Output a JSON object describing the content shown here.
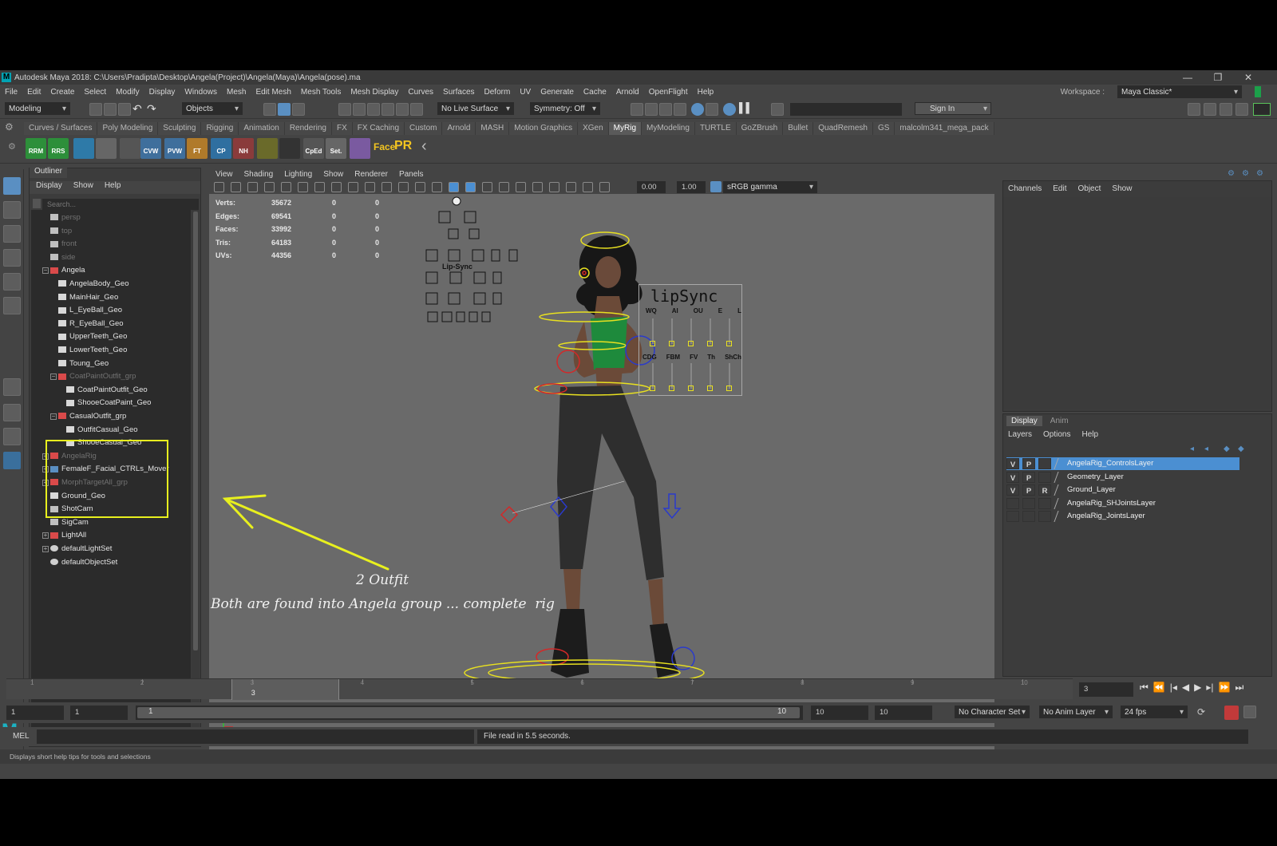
{
  "title": "Autodesk Maya 2018: C:\\Users\\Pradipta\\Desktop\\Angela(Project)\\Angela(Maya)\\Angela(pose).ma",
  "window_buttons": [
    "—",
    "❐",
    "✕"
  ],
  "menu": [
    "File",
    "Edit",
    "Create",
    "Select",
    "Modify",
    "Display",
    "Windows",
    "Mesh",
    "Edit Mesh",
    "Mesh Tools",
    "Mesh Display",
    "Curves",
    "Surfaces",
    "Deform",
    "UV",
    "Generate",
    "Cache",
    "Arnold",
    "OpenFlight",
    "Help"
  ],
  "workspace": {
    "label": "Workspace :",
    "value": "Maya Classic*"
  },
  "status": {
    "mode": "Modeling",
    "select_field": "Objects",
    "live_surface": "No Live Surface",
    "symmetry": "Symmetry: Off",
    "sign_in": "Sign In"
  },
  "shelf_tabs": [
    "Curves / Surfaces",
    "Poly Modeling",
    "Sculpting",
    "Rigging",
    "Animation",
    "Rendering",
    "FX",
    "FX Caching",
    "Custom",
    "Arnold",
    "MASH",
    "Motion Graphics",
    "XGen",
    "MyRig",
    "MyModeling",
    "TURTLE",
    "GoZBrush",
    "Bullet",
    "QuadRemesh",
    "GS",
    "malcolm341_mega_pack"
  ],
  "shelf_active": "MyRig",
  "shelf_buttons": [
    {
      "label": "RRM",
      "color": "#2d8f3a"
    },
    {
      "label": "RRS",
      "color": "#2d8f3a"
    },
    {
      "label": "",
      "color": "#2e7aa8"
    },
    {
      "label": "",
      "color": "#666"
    },
    {
      "label": "",
      "color": "#555"
    },
    {
      "label": "CVW",
      "color": "#3f6f9c"
    },
    {
      "label": "PVW",
      "color": "#3f6f9c"
    },
    {
      "label": "FT",
      "color": "#b07a2a"
    },
    {
      "label": "CP",
      "color": "#2f6fa0"
    },
    {
      "label": "NH",
      "color": "#8a3b3b"
    },
    {
      "label": "",
      "color": "#6a6a2a"
    },
    {
      "label": "",
      "color": "#333"
    },
    {
      "label": "CpEd",
      "color": "#555"
    },
    {
      "label": "Set.",
      "color": "#666"
    },
    {
      "label": "",
      "color": "#7a5aa0"
    }
  ],
  "shelf_text": {
    "face": "Face",
    "pr": "PR"
  },
  "outliner": {
    "tab": "Outliner",
    "menu": [
      "Display",
      "Show",
      "Help"
    ],
    "search_placeholder": "Search...",
    "items": [
      {
        "label": "persp",
        "dim": true,
        "icon": "camera-icon",
        "indent": 0,
        "exp": ""
      },
      {
        "label": "top",
        "dim": true,
        "icon": "camera-icon",
        "indent": 0,
        "exp": ""
      },
      {
        "label": "front",
        "dim": true,
        "icon": "camera-icon",
        "indent": 0,
        "exp": ""
      },
      {
        "label": "side",
        "dim": true,
        "icon": "camera-icon",
        "indent": 0,
        "exp": ""
      },
      {
        "label": "Angela",
        "dim": false,
        "icon": "group-icon",
        "indent": 0,
        "exp": "−"
      },
      {
        "label": "AngelaBody_Geo",
        "dim": false,
        "icon": "mesh-icon",
        "indent": 1,
        "exp": ""
      },
      {
        "label": "MainHair_Geo",
        "dim": false,
        "icon": "mesh-icon",
        "indent": 1,
        "exp": ""
      },
      {
        "label": "L_EyeBall_Geo",
        "dim": false,
        "icon": "mesh-icon",
        "indent": 1,
        "exp": ""
      },
      {
        "label": "R_EyeBall_Geo",
        "dim": false,
        "icon": "mesh-icon",
        "indent": 1,
        "exp": ""
      },
      {
        "label": "UpperTeeth_Geo",
        "dim": false,
        "icon": "mesh-icon",
        "indent": 1,
        "exp": ""
      },
      {
        "label": "LowerTeeth_Geo",
        "dim": false,
        "icon": "mesh-icon",
        "indent": 1,
        "exp": ""
      },
      {
        "label": "Toung_Geo",
        "dim": false,
        "icon": "mesh-icon",
        "indent": 1,
        "exp": ""
      },
      {
        "label": "CoatPaintOutfit_grp",
        "dim": true,
        "icon": "group-icon",
        "indent": 1,
        "exp": "−"
      },
      {
        "label": "CoatPaintOutfit_Geo",
        "dim": false,
        "icon": "mesh-icon",
        "indent": 2,
        "exp": ""
      },
      {
        "label": "ShooeCoatPaint_Geo",
        "dim": false,
        "icon": "mesh-icon",
        "indent": 2,
        "exp": ""
      },
      {
        "label": "CasualOutfit_grp",
        "dim": false,
        "icon": "group-icon",
        "indent": 1,
        "exp": "−"
      },
      {
        "label": "OutfitCasual_Geo",
        "dim": false,
        "icon": "mesh-icon",
        "indent": 2,
        "exp": ""
      },
      {
        "label": "ShooeCasual_Geo",
        "dim": false,
        "icon": "mesh-icon",
        "indent": 2,
        "exp": ""
      },
      {
        "label": "AngelaRig",
        "dim": true,
        "icon": "group-icon",
        "indent": 0,
        "exp": "+"
      },
      {
        "label": "FemaleF_Facial_CTRLs_Mover",
        "dim": false,
        "icon": "curve-icon",
        "indent": 0,
        "exp": "+"
      },
      {
        "label": "MorphTargetAll_grp",
        "dim": true,
        "icon": "group-icon",
        "indent": 0,
        "exp": "+"
      },
      {
        "label": "Ground_Geo",
        "dim": false,
        "icon": "mesh-icon",
        "indent": 0,
        "exp": ""
      },
      {
        "label": "ShotCam",
        "dim": false,
        "icon": "camera-icon",
        "indent": 0,
        "exp": ""
      },
      {
        "label": "SigCam",
        "dim": false,
        "icon": "camera-icon",
        "indent": 0,
        "exp": ""
      },
      {
        "label": "LightAll",
        "dim": false,
        "icon": "group-icon",
        "indent": 0,
        "exp": "+"
      },
      {
        "label": "defaultLightSet",
        "dim": false,
        "icon": "set-icon",
        "indent": 0,
        "exp": "+"
      },
      {
        "label": "defaultObjectSet",
        "dim": false,
        "icon": "set-icon",
        "indent": 0,
        "exp": ""
      }
    ]
  },
  "viewport": {
    "menu": [
      "View",
      "Shading",
      "Lighting",
      "Show",
      "Renderer",
      "Panels"
    ],
    "exposure": "0.00",
    "gamma": "1.00",
    "color_space": "sRGB gamma",
    "camera": "persp",
    "hud": [
      {
        "label": "Verts:",
        "v1": "35672",
        "v2": "0",
        "v3": "0"
      },
      {
        "label": "Edges:",
        "v1": "69541",
        "v2": "0",
        "v3": "0"
      },
      {
        "label": "Faces:",
        "v1": "33992",
        "v2": "0",
        "v3": "0"
      },
      {
        "label": "Tris:",
        "v1": "64183",
        "v2": "0",
        "v3": "0"
      },
      {
        "label": "UVs:",
        "v1": "44356",
        "v2": "0",
        "v3": "0"
      }
    ],
    "lipsync": {
      "title": "lipSync",
      "row1": [
        "WQ",
        "AI",
        "OU",
        "E",
        "L"
      ],
      "row2": [
        "CDG",
        "FBM",
        "FV",
        "Th",
        "ShCh"
      ]
    },
    "rig_panel_labels": [
      "Lip-Sync"
    ],
    "annotation_line1": "2 Outfit",
    "annotation_line2": "Both are found into Angela group ... complete  rig"
  },
  "channel_box": {
    "menu": [
      "Channels",
      "Edit",
      "Object",
      "Show"
    ]
  },
  "layer_editor": {
    "tabs": [
      "Display",
      "Anim"
    ],
    "menu": [
      "Layers",
      "Options",
      "Help"
    ],
    "layers": [
      {
        "v": "V",
        "p": "P",
        "r": "",
        "name": "AngelaRig_ControlsLayer",
        "selected": true
      },
      {
        "v": "V",
        "p": "P",
        "r": "",
        "name": "Geometry_Layer",
        "selected": false
      },
      {
        "v": "V",
        "p": "P",
        "r": "R",
        "name": "Ground_Layer",
        "selected": false
      },
      {
        "v": "",
        "p": "",
        "r": "",
        "name": "AngelaRig_SHJointsLayer",
        "selected": false
      },
      {
        "v": "",
        "p": "",
        "r": "",
        "name": "AngelaRig_JointsLayer",
        "selected": false
      }
    ]
  },
  "timeline": {
    "ticks": [
      "1",
      "2",
      "3",
      "4",
      "5",
      "6",
      "7",
      "8",
      "9",
      "10"
    ],
    "current": "3",
    "current_field": "3"
  },
  "range": {
    "start": "1",
    "anim_start": "1",
    "slider_start": "1",
    "slider_end": "10",
    "anim_end": "10",
    "end": "10",
    "character_set": "No Character Set",
    "anim_layer": "No Anim Layer",
    "fps": "24 fps"
  },
  "command": {
    "mode": "MEL",
    "result": "File read in  5.5 seconds."
  },
  "help_line": "Displays short help tips for tools and selections",
  "colors": {
    "accent": "#4b8fd2",
    "annotation": "#e8f01e",
    "control": "#e8e020",
    "ik": "#2a3acb",
    "fk": "#d42828"
  }
}
